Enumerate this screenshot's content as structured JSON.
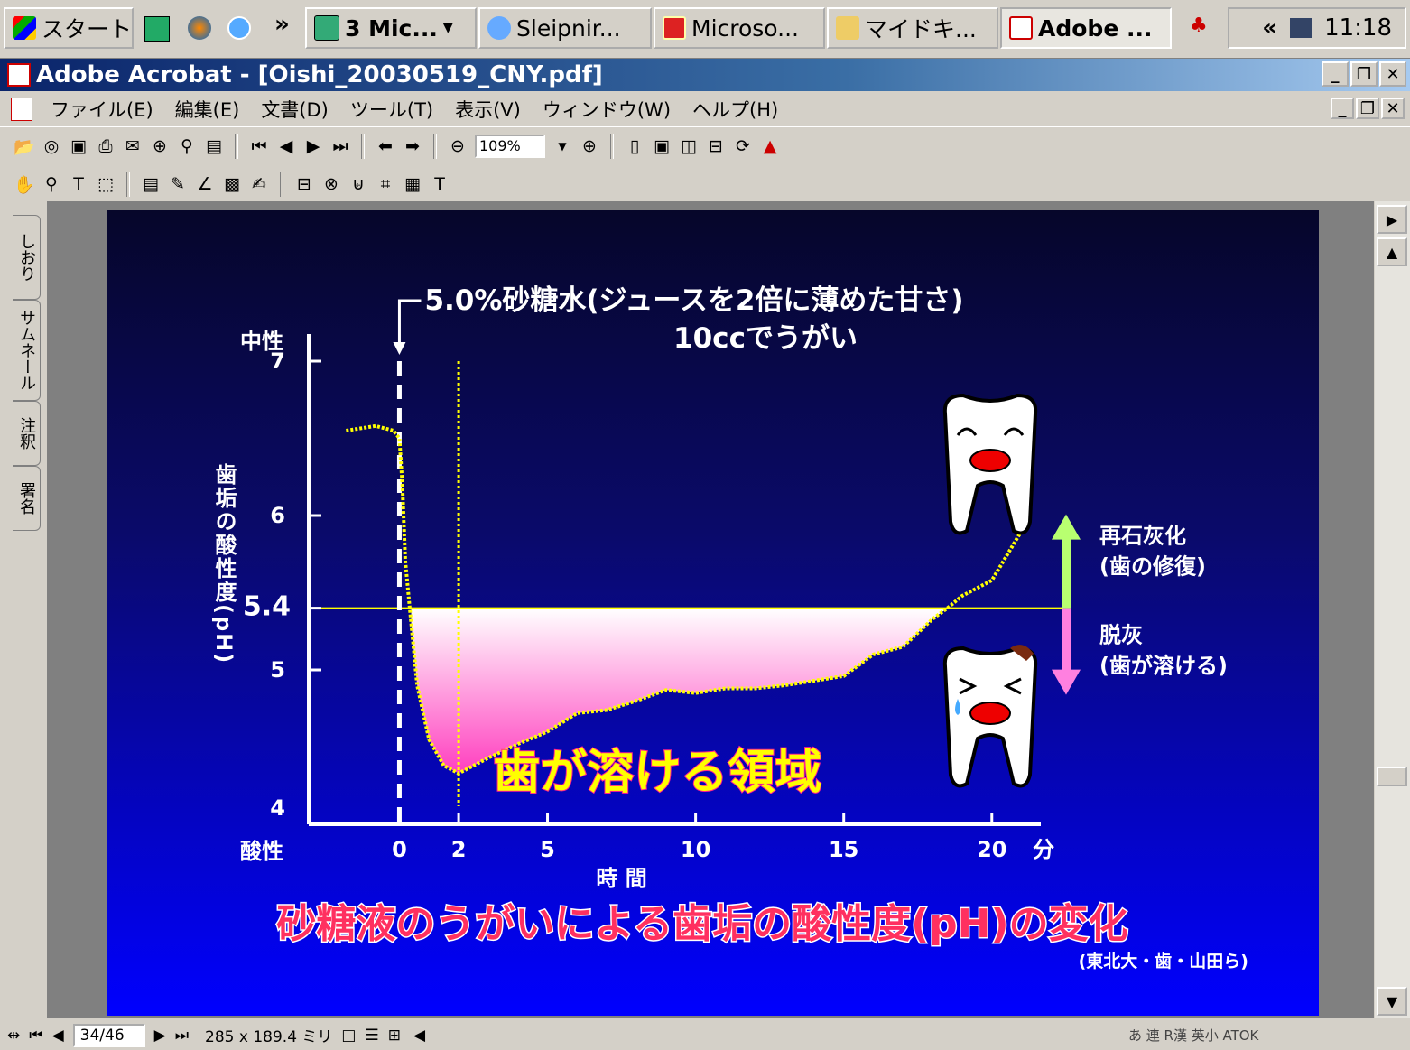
{
  "taskbar": {
    "start": "スタート",
    "quick_more": "»",
    "buttons": [
      "3 Mic...",
      "Sleipnir...",
      "Microso...",
      "マイドキ...",
      "Adobe ..."
    ],
    "tray_more": "«",
    "clock": "11:18"
  },
  "window": {
    "title": "Adobe Acrobat - [Oishi_20030519_CNY.pdf]",
    "menus": [
      "ファイル(E)",
      "編集(E)",
      "文書(D)",
      "ツール(T)",
      "表示(V)",
      "ウィンドウ(W)",
      "ヘルプ(H)"
    ],
    "zoom": "109%"
  },
  "side_tabs": [
    "しおり",
    "サムネール",
    "注釈",
    "署名"
  ],
  "status": {
    "page": "34/46",
    "size": "285 x 189.4 ミリ",
    "ime": "あ 連 R漢 英小 ATOK"
  },
  "slide": {
    "annotation_line1": "5.0%砂糖水(ジュースを2倍に薄めた甘さ)",
    "annotation_line2": "10ccでうがい",
    "neutral_label": "中性",
    "acidic_label": "酸性",
    "ylabel": "歯垢の酸性度(pH)",
    "xlabel": "時 間",
    "unit": "分",
    "region_label": "歯が溶ける領域",
    "remin_label_1": "再石灰化",
    "remin_label_2": "(歯の修復)",
    "demin_label_1": "脱灰",
    "demin_label_2": "(歯が溶ける)",
    "title": "砂糖液のうがいによる歯垢の酸性度(pH)の変化",
    "source": "(東北大・歯・山田ら)"
  },
  "chart_data": {
    "type": "line",
    "title": "砂糖液のうがいによる歯垢の酸性度(pH)の変化",
    "xlabel": "時 間",
    "ylabel": "歯垢の酸性度(pH)",
    "x_ticks": [
      "0",
      "2",
      "5",
      "10",
      "15",
      "20"
    ],
    "y_ticks": [
      "4",
      "5",
      "5.4",
      "6",
      "7"
    ],
    "xlim": [
      -3,
      21.5
    ],
    "ylim": [
      4,
      7
    ],
    "threshold": 5.4,
    "rinse_time": 0,
    "marker_time": 2,
    "series": [
      {
        "x": [
          -1.8,
          -0.8,
          -0.2,
          0,
          0.1,
          0.2,
          0.4,
          0.6,
          1,
          1.5,
          2,
          3,
          4,
          5,
          6,
          7,
          8,
          9,
          10,
          11,
          12,
          13,
          14,
          15,
          16,
          17,
          18,
          18.5,
          19,
          20,
          21
        ],
        "y": [
          6.55,
          6.58,
          6.55,
          6.5,
          6.2,
          5.7,
          5.3,
          4.9,
          4.55,
          4.38,
          4.33,
          4.43,
          4.52,
          4.6,
          4.72,
          4.74,
          4.8,
          4.87,
          4.85,
          4.88,
          4.88,
          4.9,
          4.93,
          4.96,
          5.1,
          5.15,
          5.33,
          5.4,
          5.48,
          5.58,
          5.9
        ]
      }
    ]
  }
}
